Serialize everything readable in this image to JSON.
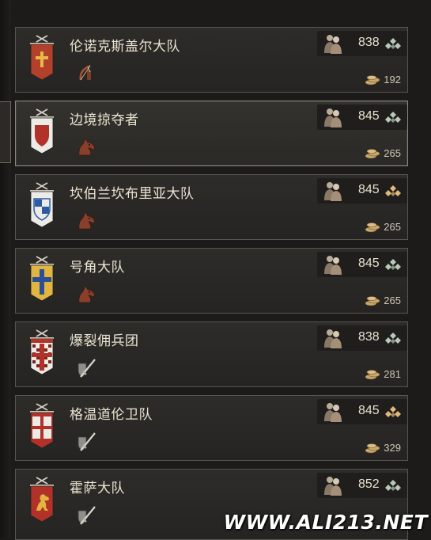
{
  "regiments": [
    {
      "name": "伦诺克斯盖尔大队",
      "count": "838",
      "cost": "192",
      "banner": "red-cross-banner",
      "unit": "archer-icon",
      "tier": "silver",
      "selected": false
    },
    {
      "name": "边境掠夺者",
      "count": "845",
      "cost": "265",
      "banner": "white-red-shield-banner",
      "unit": "horse-icon",
      "tier": "silver",
      "selected": true
    },
    {
      "name": "坎伯兰坎布里亚大队",
      "count": "845",
      "cost": "265",
      "banner": "blue-white-checks-banner",
      "unit": "horse-icon",
      "tier": "gold",
      "selected": false
    },
    {
      "name": "号角大队",
      "count": "845",
      "cost": "265",
      "banner": "yellow-blue-cross-banner",
      "unit": "horse-icon",
      "tier": "silver",
      "selected": false
    },
    {
      "name": "爆裂佣兵团",
      "count": "838",
      "cost": "281",
      "banner": "red-checkered-banner",
      "unit": "sword-shield-icon",
      "tier": "silver",
      "selected": false
    },
    {
      "name": "格温道伦卫队",
      "count": "845",
      "cost": "329",
      "banner": "white-red-quartered-banner",
      "unit": "sword-shield-icon",
      "tier": "gold",
      "selected": false
    },
    {
      "name": "霍萨大队",
      "count": "852",
      "cost": "",
      "banner": "red-lion-banner",
      "unit": "sword-shield-icon",
      "tier": "silver",
      "selected": false
    }
  ],
  "colors": {
    "silver_tier": "#b9c9b8",
    "gold_tier": "#e0b878",
    "coin": "#c9a66b"
  },
  "watermark": "WWW.ALI213.NET"
}
